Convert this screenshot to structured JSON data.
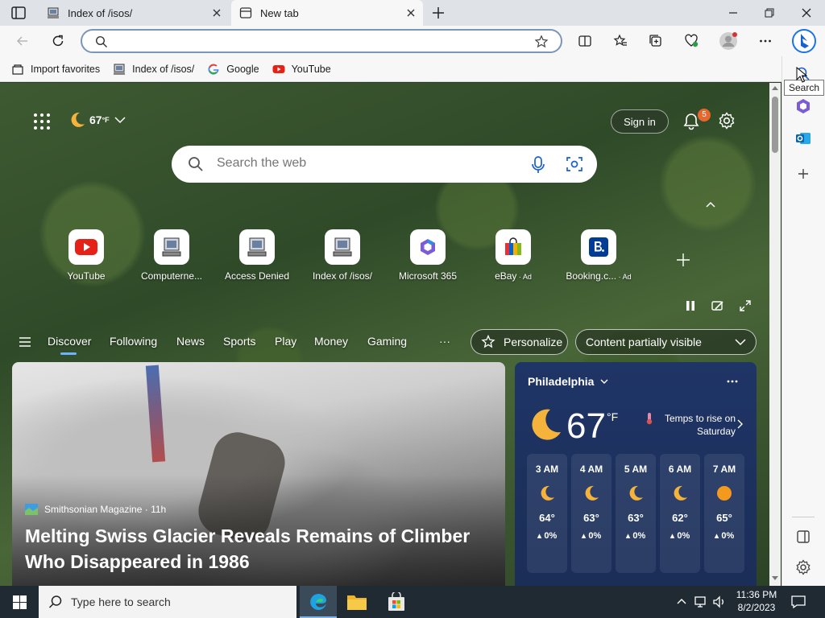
{
  "tabs": [
    {
      "title": "Index of /isos/",
      "active": false
    },
    {
      "title": "New tab",
      "active": true
    }
  ],
  "address": {
    "value": "",
    "placeholder": ""
  },
  "favorites": [
    {
      "label": "Import favorites",
      "icon": "import-icon"
    },
    {
      "label": "Index of /isos/",
      "icon": "computer-icon"
    },
    {
      "label": "Google",
      "icon": "google-icon"
    },
    {
      "label": "YouTube",
      "icon": "youtube-icon"
    }
  ],
  "sidebar": {
    "tooltip": "Search"
  },
  "header": {
    "temp": "67",
    "temp_unit": "°F",
    "signin": "Sign in",
    "notifications": "5"
  },
  "search": {
    "placeholder": "Search the web"
  },
  "quicklinks": [
    {
      "label": "YouTube",
      "ad": ""
    },
    {
      "label": "Computerne...",
      "ad": ""
    },
    {
      "label": "Access Denied",
      "ad": ""
    },
    {
      "label": "Index of /isos/",
      "ad": ""
    },
    {
      "label": "Microsoft 365",
      "ad": ""
    },
    {
      "label": "eBay",
      "ad": " · Ad"
    },
    {
      "label": "Booking.c...",
      "ad": " · Ad"
    }
  ],
  "feed_nav": {
    "items": [
      "Discover",
      "Following",
      "News",
      "Sports",
      "Play",
      "Money",
      "Gaming"
    ],
    "more": "···",
    "personalize": "Personalize",
    "visibility": "Content partially visible"
  },
  "news": {
    "source": "Smithsonian Magazine · 11h",
    "headline": "Melting Swiss Glacier Reveals Remains of Climber Who Disappeared in 1986"
  },
  "weather": {
    "city": "Philadelphia",
    "temp": "67",
    "unit": "°F",
    "note": "Temps to rise on Saturday",
    "hours": [
      {
        "hour": "3 AM",
        "temp": "64°",
        "precip": "0%",
        "icon": "moon-icon"
      },
      {
        "hour": "4 AM",
        "temp": "63°",
        "precip": "0%",
        "icon": "moon-icon"
      },
      {
        "hour": "5 AM",
        "temp": "63°",
        "precip": "0%",
        "icon": "moon-icon"
      },
      {
        "hour": "6 AM",
        "temp": "62°",
        "precip": "0%",
        "icon": "moon-icon"
      },
      {
        "hour": "7 AM",
        "temp": "65°",
        "precip": "0%",
        "icon": "sun-icon"
      }
    ]
  },
  "taskbar": {
    "search_placeholder": "Type here to search",
    "time": "11:36 PM",
    "date": "8/2/2023"
  },
  "colors": {
    "accent": "#0f6cbd",
    "weather_bg": "#1f3566",
    "badge": "#e8672f"
  }
}
